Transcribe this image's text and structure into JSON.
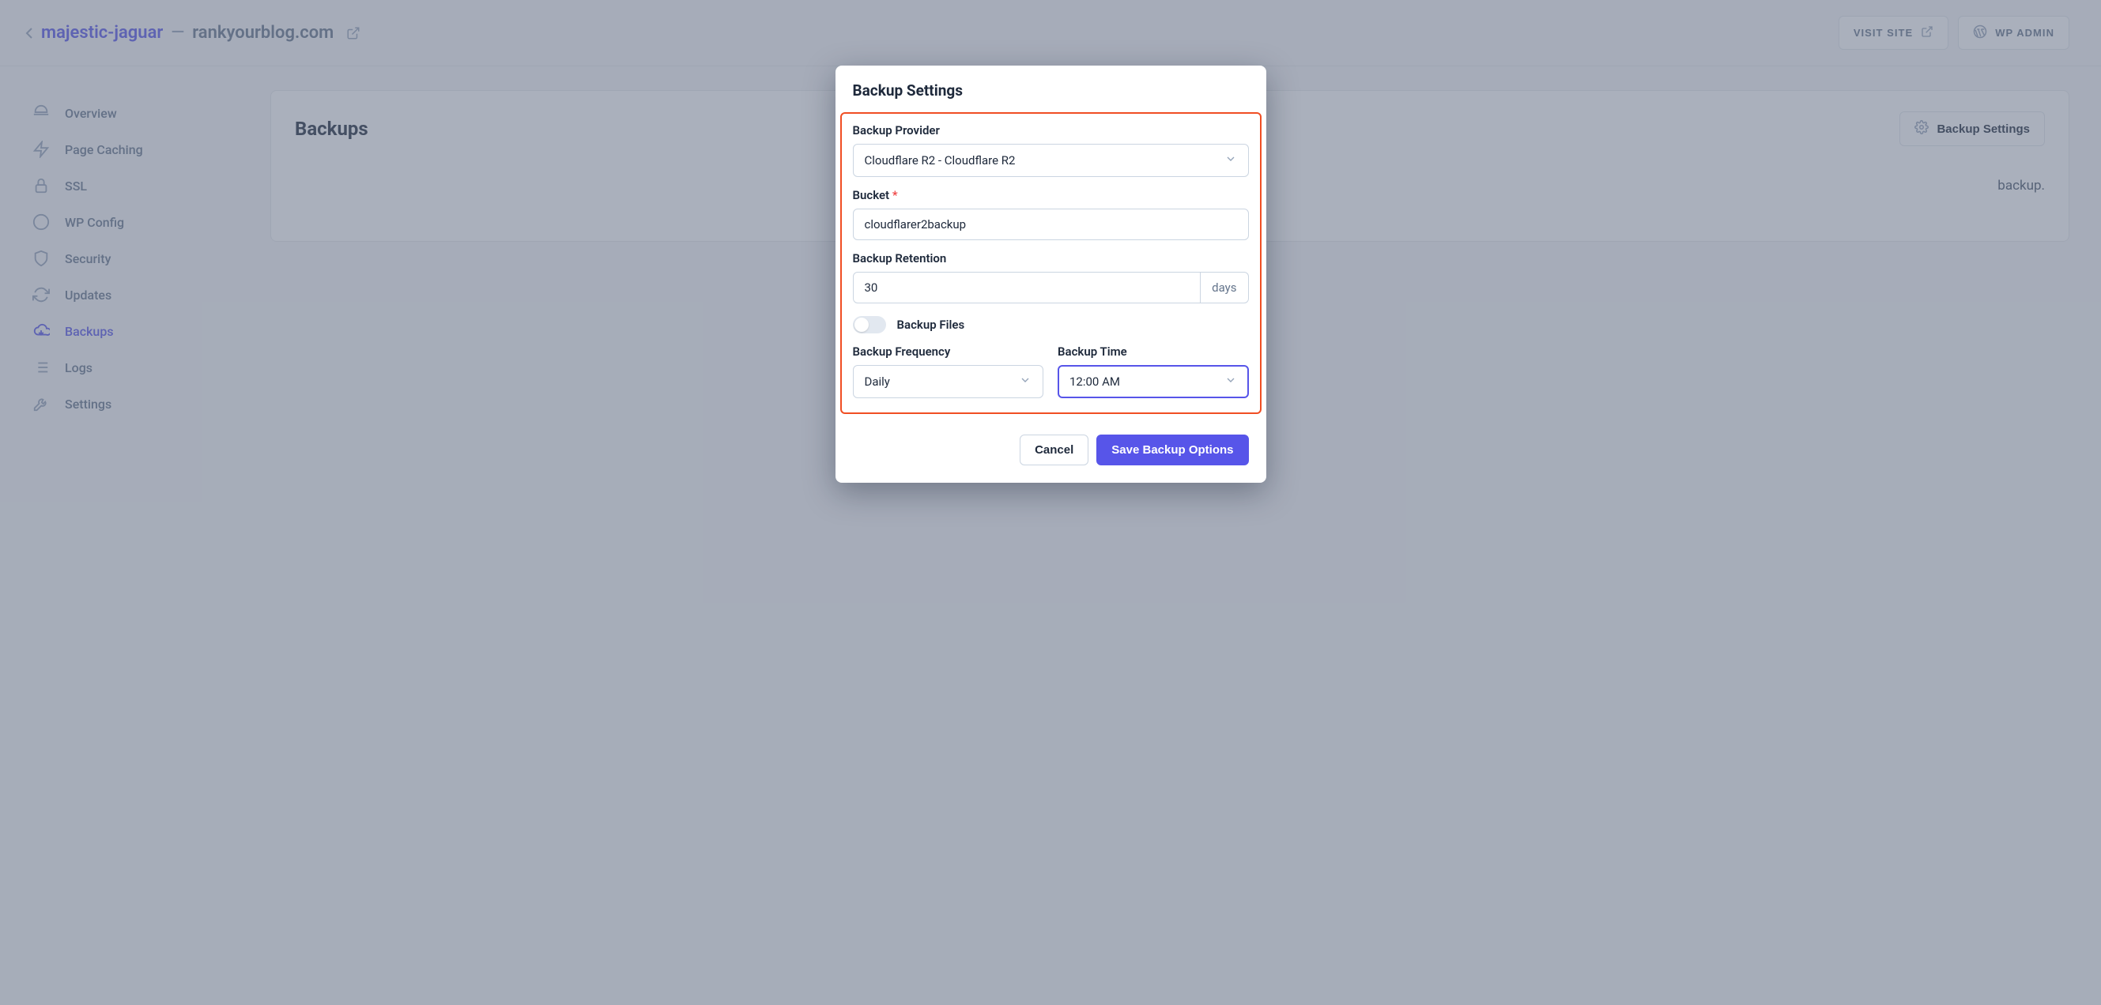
{
  "header": {
    "site_name": "majestic-jaguar",
    "separator": "—",
    "domain": "rankyourblog.com",
    "visit_site_label": "VISIT SITE",
    "wp_admin_label": "WP ADMIN"
  },
  "sidebar": {
    "items": [
      {
        "label": "Overview"
      },
      {
        "label": "Page Caching"
      },
      {
        "label": "SSL"
      },
      {
        "label": "WP Config"
      },
      {
        "label": "Security"
      },
      {
        "label": "Updates"
      },
      {
        "label": "Backups"
      },
      {
        "label": "Logs"
      },
      {
        "label": "Settings"
      }
    ]
  },
  "content": {
    "card_title": "Backups",
    "settings_button": "Backup Settings",
    "placeholder_fragment": "backup."
  },
  "modal": {
    "title": "Backup Settings",
    "provider_label": "Backup Provider",
    "provider_value": "Cloudflare R2 - Cloudflare R2",
    "bucket_label": "Bucket",
    "bucket_value": "cloudflarer2backup",
    "retention_label": "Backup Retention",
    "retention_value": "30",
    "retention_unit": "days",
    "backup_files_label": "Backup Files",
    "backup_files_on": false,
    "frequency_label": "Backup Frequency",
    "frequency_value": "Daily",
    "time_label": "Backup Time",
    "time_value": "12:00 AM",
    "cancel_label": "Cancel",
    "save_label": "Save Backup Options"
  },
  "colors": {
    "accent": "#5755e9",
    "highlight_border": "#f04e23"
  }
}
